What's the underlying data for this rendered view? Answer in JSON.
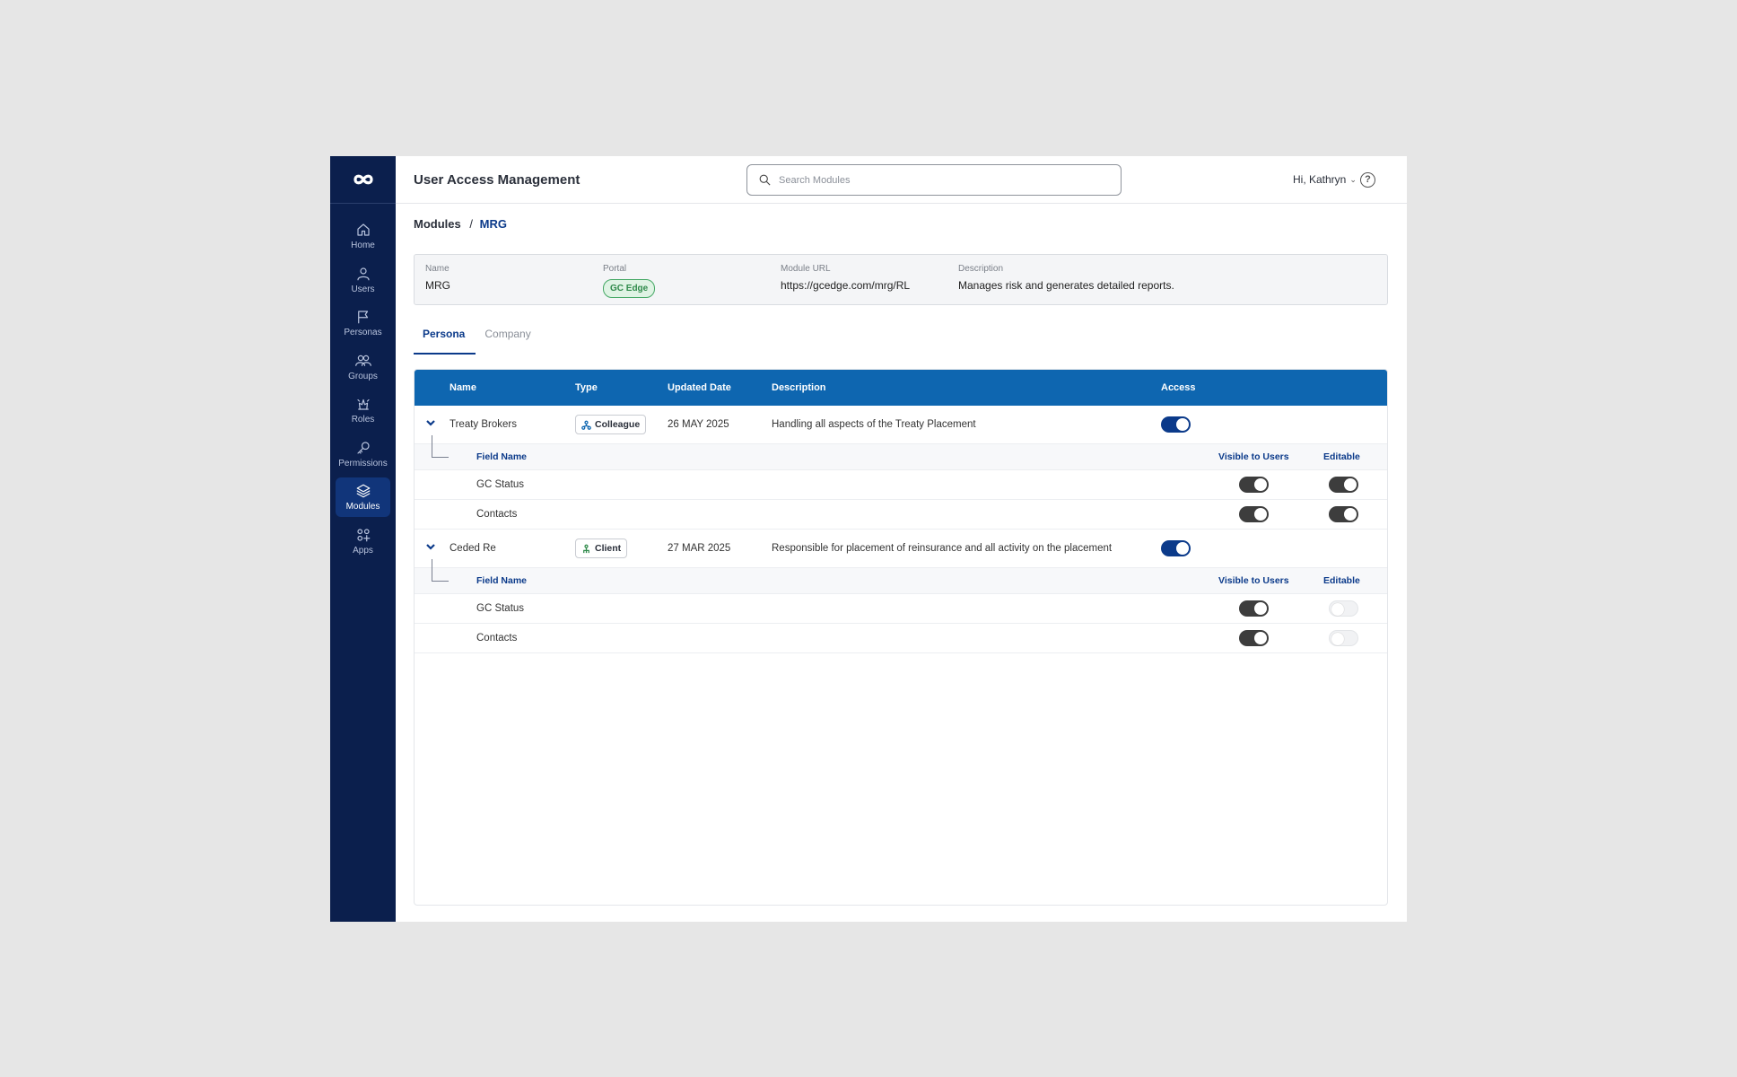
{
  "sidebar": {
    "items": [
      {
        "label": "Home",
        "icon": "home-icon"
      },
      {
        "label": "Users",
        "icon": "user-icon"
      },
      {
        "label": "Personas",
        "icon": "flag-icon"
      },
      {
        "label": "Groups",
        "icon": "groups-icon"
      },
      {
        "label": "Roles",
        "icon": "roles-icon"
      },
      {
        "label": "Permissions",
        "icon": "key-icon"
      },
      {
        "label": "Modules",
        "icon": "layers-icon",
        "active": true
      },
      {
        "label": "Apps",
        "icon": "apps-icon"
      }
    ]
  },
  "header": {
    "title": "User Access Management",
    "search_placeholder": "Search Modules",
    "greeting": "Hi, Kathryn",
    "help_icon": "?"
  },
  "breadcrumb": {
    "parent": "Modules",
    "separator": "/",
    "current": "MRG"
  },
  "module_info": {
    "name_label": "Name",
    "name_value": "MRG",
    "portal_label": "Portal",
    "portal_value": "GC Edge",
    "url_label": "Module URL",
    "url_value": "https://gcedge.com/mrg/RL",
    "description_label": "Description",
    "description_value": "Manages risk and generates detailed reports."
  },
  "tabs": [
    {
      "label": "Persona",
      "active": true
    },
    {
      "label": "Company",
      "active": false
    }
  ],
  "table": {
    "columns": [
      "Name",
      "Type",
      "Updated Date",
      "Description",
      "Access"
    ],
    "sub_columns": [
      "Field Name",
      "Visible to Users",
      "Editable"
    ],
    "rows": [
      {
        "name": "Treaty Brokers",
        "type": "Colleague",
        "updated": "26 MAY 2025",
        "description": "Handling all aspects of the Treaty Placement",
        "access": true,
        "fields": [
          {
            "name": "GC Status",
            "visible": true,
            "editable": true
          },
          {
            "name": "Contacts",
            "visible": true,
            "editable": true
          }
        ]
      },
      {
        "name": "Ceded Re",
        "type": "Client",
        "updated": "27 MAR 2025",
        "description": "Responsible for placement of reinsurance and all activity on the placement",
        "access": true,
        "fields": [
          {
            "name": "GC Status",
            "visible": true,
            "editable": false
          },
          {
            "name": "Contacts",
            "visible": true,
            "editable": false
          }
        ]
      }
    ]
  },
  "colors": {
    "sidebar": "#0b1f4d",
    "table_header": "#0e66b0",
    "accent": "#0b3a8a",
    "portal_green": "#2f8a4a"
  }
}
